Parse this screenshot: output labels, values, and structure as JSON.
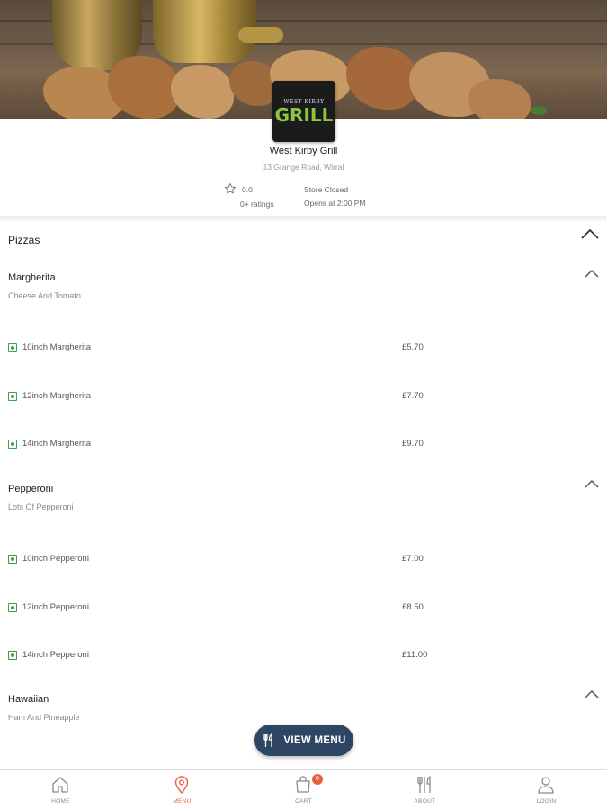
{
  "store": {
    "logo_top": "WEST KIRBY",
    "logo_main": "GRILL",
    "name": "West Kirby Grill",
    "address": "13 Grange Road, Wirral",
    "rating": "0.0",
    "rating_count": "0+ ratings",
    "status": "Store Closed",
    "opens": "Opens at 2:00 PM"
  },
  "menu": {
    "section_title": "Pizzas",
    "items": [
      {
        "name": "Margherita",
        "description": "Cheese And Tomato",
        "variants": [
          {
            "name": "10inch Margherita",
            "price": "£5.70"
          },
          {
            "name": "12inch Margherita",
            "price": "£7.70"
          },
          {
            "name": "14inch Margherita",
            "price": "£9.70"
          }
        ]
      },
      {
        "name": "Pepperoni",
        "description": "Lots Of Pepperoni",
        "variants": [
          {
            "name": "10inch Pepperoni",
            "price": "£7.00"
          },
          {
            "name": "12inch Pepperoni",
            "price": "£8.50"
          },
          {
            "name": "14inch Pepperoni",
            "price": "£11.00"
          }
        ]
      },
      {
        "name": "Hawaiian",
        "description": "Ham And Pineapple",
        "variants": []
      }
    ]
  },
  "fab": {
    "label": "VIEW MENU",
    "icon": "cutlery-icon"
  },
  "nav": {
    "items": [
      {
        "label": "HOME",
        "icon": "home-icon"
      },
      {
        "label": "MENU",
        "icon": "location-pin-icon"
      },
      {
        "label": "CART",
        "icon": "shopping-bag-icon"
      },
      {
        "label": "ABOUT",
        "icon": "cutlery-icon"
      },
      {
        "label": "LOGIN",
        "icon": "user-icon"
      }
    ],
    "cart_count": "0"
  },
  "colors": {
    "accent": "#e8613c",
    "fab_bg": "#2e4563",
    "veg_green": "#3aa04a",
    "logo_green": "#8cc63f"
  }
}
